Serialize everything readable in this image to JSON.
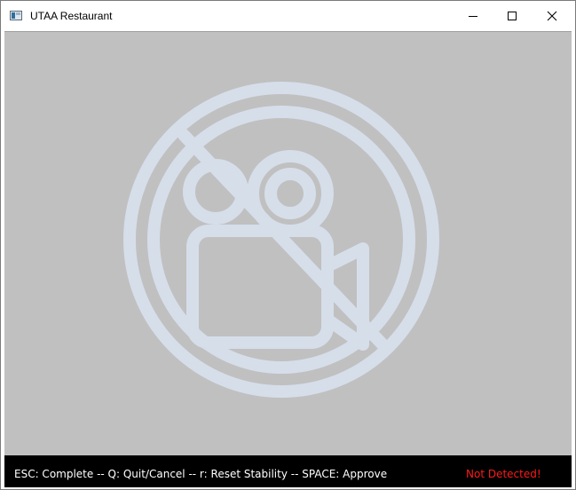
{
  "window": {
    "title": "UTAA Restaurant",
    "icon": "app-window-icon",
    "controls": {
      "minimize_icon": "minimize-icon",
      "maximize_icon": "maximize-icon",
      "close_icon": "close-icon"
    }
  },
  "video": {
    "state_icon": "no-video-camera-icon",
    "background_color": "#c0c0c0",
    "icon_color": "#d6deea"
  },
  "statusbar": {
    "instructions": "ESC: Complete -- Q: Quit/Cancel -- r: Reset Stability -- SPACE: Approve",
    "detection_status": "Not Detected!",
    "detection_color": "#ff1a1a"
  }
}
